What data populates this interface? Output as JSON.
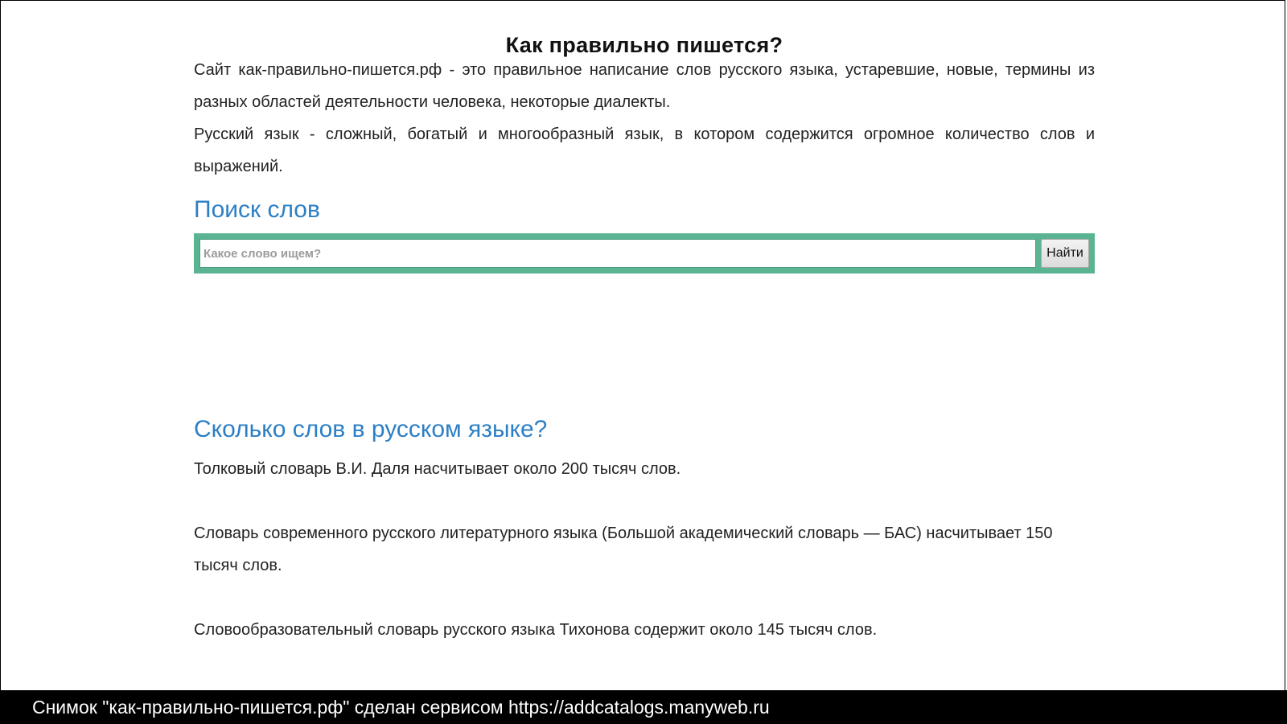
{
  "page": {
    "title": "Как правильно пишется?"
  },
  "intro": {
    "paragraph_1": "Сайт как-правильно-пишется.рф - это правильное написание слов русского языка, устаревшие, новые, термины из разных областей деятельности человека, некоторые диалекты.",
    "paragraph_2": "Русский язык - сложный, богатый и многообразный язык, в котором содержится огромное количество слов и выражений."
  },
  "search": {
    "heading": "Поиск слов",
    "placeholder": "Какое слово ищем?",
    "value": "",
    "button_label": "Найти",
    "accent_color": "#5ab391"
  },
  "word_count": {
    "heading": "Сколько слов в русском языке?",
    "items": [
      "Толковый словарь В.И. Даля насчитывает около 200 тысяч слов.",
      "Словарь современного русского литературного языка (Большой академический словарь — БАС) насчитывает 150 тысяч слов.",
      "Словообразовательный словарь русского языка Тихонова содержит около 145 тысяч слов."
    ]
  },
  "watermark": {
    "text": "Снимок \"как-правильно-пишется.рф\" сделан сервисом https://addcatalogs.manyweb.ru"
  },
  "colors": {
    "heading_blue": "#2d7fc5",
    "watermark_bg": "#000000"
  }
}
